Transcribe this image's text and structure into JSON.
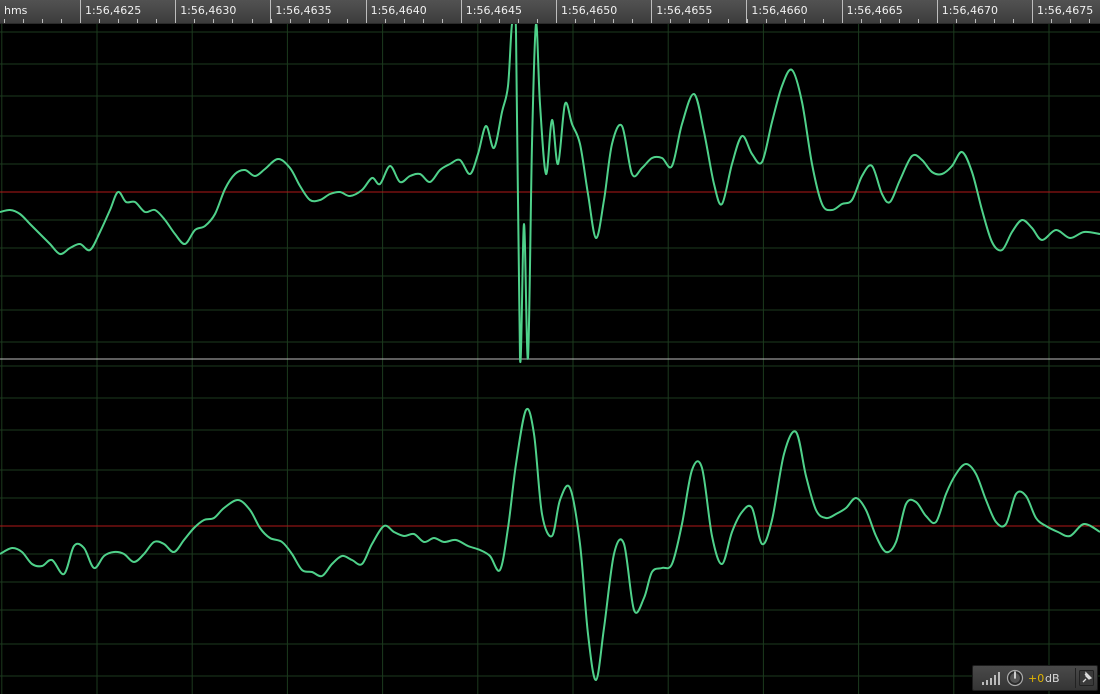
{
  "ruler": {
    "unit_label": "hms",
    "ticks": [
      {
        "label": "1:56,4625"
      },
      {
        "label": "1:56,4630"
      },
      {
        "label": "1:56,4635"
      },
      {
        "label": "1:56,4640"
      },
      {
        "label": "1:56,4645"
      },
      {
        "label": "1:56,4650"
      },
      {
        "label": "1:56,4655"
      },
      {
        "label": "1:56,4660"
      },
      {
        "label": "1:56,4665"
      },
      {
        "label": "1:56,4670"
      },
      {
        "label": "1:56,4675"
      }
    ]
  },
  "waveform": {
    "channels": [
      {
        "name": "top-channel"
      },
      {
        "name": "bottom-channel"
      }
    ]
  },
  "level_panel": {
    "gain_value": "+0",
    "gain_unit": "dB",
    "icons": {
      "bars": "signal-bars-icon",
      "knob": "volume-knob-icon",
      "pin": "pin-icon"
    }
  },
  "colors": {
    "background": "#000000",
    "wave": "#4fd18a",
    "grid": "#1c3a1e",
    "center_line": "#b01818",
    "divider": "#bdbdbd",
    "gain_value": "#e0b400"
  }
}
